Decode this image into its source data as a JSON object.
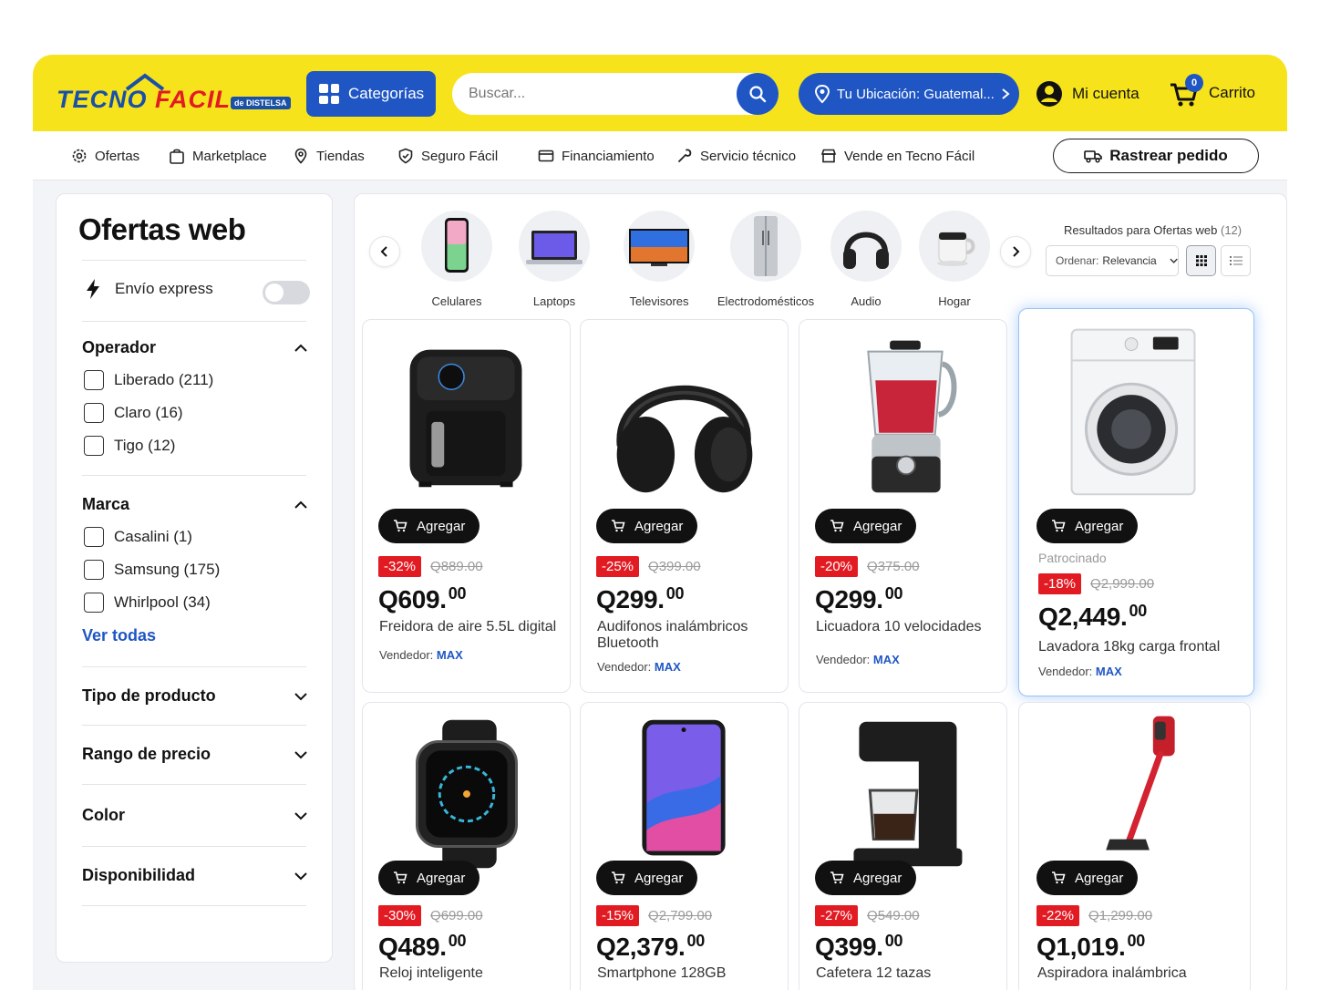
{
  "brand": {
    "name_a": "TECNO",
    "name_b": "FACIL",
    "badge": "de DISTELSA",
    "blue": "#1950a8",
    "red": "#e21b23",
    "yellow": "#f7e31c"
  },
  "header": {
    "categories_label": "Categorías",
    "search_placeholder": "Buscar...",
    "location_label": "Tu Ubicación: Guatemal...",
    "account_label": "Mi cuenta",
    "cart_label": "Carrito",
    "cart_count": "0"
  },
  "nav": {
    "items": [
      {
        "label": "Ofertas",
        "icon": "gear-icon"
      },
      {
        "label": "Marketplace",
        "icon": "bag-icon"
      },
      {
        "label": "Tiendas",
        "icon": "pin-icon"
      },
      {
        "label": "Seguro Fácil",
        "icon": "shield-icon"
      },
      {
        "label": "Financiamiento",
        "icon": "card-icon"
      },
      {
        "label": "Servicio técnico",
        "icon": "wrench-icon"
      },
      {
        "label": "Vende en Tecno Fácil",
        "icon": "store-icon"
      }
    ],
    "track_label": "Rastrear pedido"
  },
  "sidebar": {
    "title": "Ofertas web",
    "express_label": "Envío express",
    "express_on": false,
    "operador": {
      "title": "Operador",
      "options": [
        "Liberado (211)",
        "Claro (16)",
        "Tigo (12)"
      ]
    },
    "marca": {
      "title": "Marca",
      "options": [
        "Casalini (1)",
        "Samsung (175)",
        "Whirlpool (34)"
      ],
      "see_all": "Ver todas"
    },
    "collapsed": [
      "Tipo de producto",
      "Rango de precio",
      "Color",
      "Disponibilidad"
    ]
  },
  "categories": [
    "Celulares",
    "Laptops",
    "Televisores",
    "Electrodomésticos",
    "Audio",
    "Hogar"
  ],
  "results": {
    "text": "Resultados para Ofertas web",
    "count": "(12)",
    "sort_label": "Ordenar:",
    "sort_value": "Relevancia"
  },
  "add_label": "Agregar",
  "seller_prefix": "Vendedor:",
  "sponsored_label": "Patrocinado",
  "products": [
    {
      "discount": "-32%",
      "old": "Q889.00",
      "price": "Q609.",
      "cents": "00",
      "name": "Freidora de aire 5.5L digital",
      "seller": "MAX",
      "icon": "air-fryer"
    },
    {
      "discount": "-25%",
      "old": "Q399.00",
      "price": "Q299.",
      "cents": "00",
      "name": "Audifonos inalámbricos Bluetooth",
      "seller": "MAX",
      "icon": "headphones"
    },
    {
      "discount": "-20%",
      "old": "Q375.00",
      "price": "Q299.",
      "cents": "00",
      "name": "Licuadora 10 velocidades",
      "seller": "MAX",
      "icon": "blender"
    },
    {
      "discount": "-18%",
      "old": "Q2,999.00",
      "price": "Q2,449.",
      "cents": "00",
      "name": "Lavadora 18kg carga frontal",
      "seller": "MAX",
      "icon": "washer",
      "sponsored": true
    },
    {
      "discount": "-30%",
      "old": "Q699.00",
      "price": "Q489.",
      "cents": "00",
      "name": "Reloj inteligente",
      "icon": "smartwatch"
    },
    {
      "discount": "-15%",
      "old": "Q2,799.00",
      "price": "Q2,379.",
      "cents": "00",
      "name": "Smartphone 128GB",
      "icon": "smartphone"
    },
    {
      "discount": "-27%",
      "old": "Q549.00",
      "price": "Q399.",
      "cents": "00",
      "name": "Cafetera 12 tazas",
      "icon": "coffee-maker"
    },
    {
      "discount": "-22%",
      "old": "Q1,299.00",
      "price": "Q1,019.",
      "cents": "00",
      "name": "Aspiradora inalámbrica",
      "icon": "stick-vacuum"
    }
  ]
}
